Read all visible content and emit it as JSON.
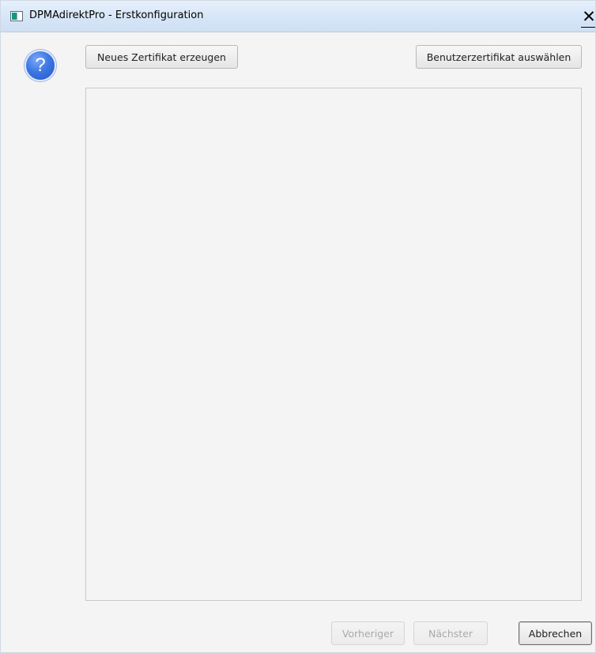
{
  "window": {
    "title": "DPMAdirektPro - Erstkonfiguration",
    "close_glyph": "✕"
  },
  "icons": {
    "app": "application-window-icon",
    "help": "question-mark-icon",
    "help_glyph": "?"
  },
  "toolbar": {
    "new_cert_label": "Neues Zertifikat erzeugen",
    "select_user_cert_label": "Benutzerzertifikat auswählen"
  },
  "footer": {
    "prev_label": "Vorheriger",
    "next_label": "Nächster",
    "cancel_label": "Abbrechen"
  },
  "colors": {
    "help_icon_blue": "#3d78e4",
    "disabled_text": "#a9a9a9"
  }
}
